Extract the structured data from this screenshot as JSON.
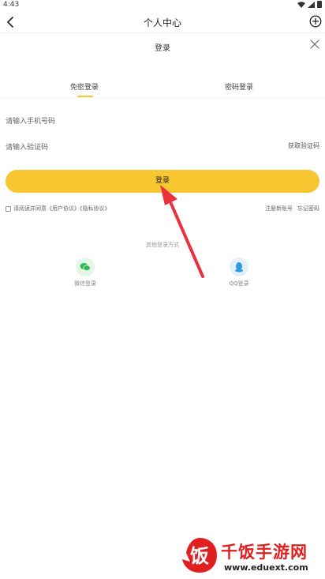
{
  "status_bar": {
    "time": "4:43"
  },
  "nav": {
    "title": "个人中心"
  },
  "sheet": {
    "title": "登录"
  },
  "tabs": [
    {
      "label": "免密登录",
      "active": true
    },
    {
      "label": "密码登录",
      "active": false
    }
  ],
  "form": {
    "phone_placeholder": "请输入手机号码",
    "code_placeholder": "请输入验证码",
    "get_code_label": "获取验证码",
    "login_label": "登录"
  },
  "agreement": {
    "text": "请阅读并同意《用户协议》《隐私协议》",
    "register_label": "注册新账号",
    "forgot_label": "忘记密码"
  },
  "other_login": {
    "title": "其他登录方式",
    "wechat_label": "微信登录",
    "qq_label": "QQ登录"
  },
  "watermark": {
    "name": "千饭手游网",
    "url": "www.eduext.com",
    "logo_char": "饭"
  },
  "colors": {
    "accent": "#f7c631",
    "wechat": "#2dbb55",
    "qq": "#2e9be6",
    "arrow": "#e8313d",
    "watermark": "#e02020"
  }
}
